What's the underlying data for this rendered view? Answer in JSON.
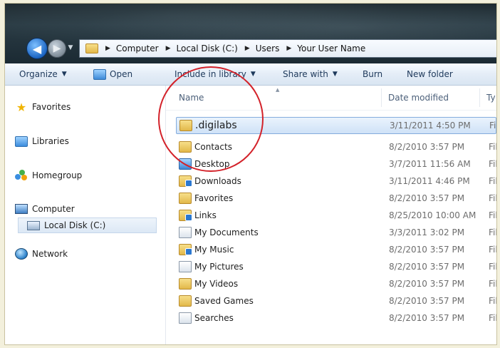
{
  "address_bar": {
    "crumbs": [
      "Computer",
      "Local Disk (C:)",
      "Users",
      "Your User Name"
    ]
  },
  "toolbar": {
    "organize": "Organize",
    "open": "Open",
    "include_in_library": "Include in library",
    "share_with": "Share with",
    "burn": "Burn",
    "new_folder": "New folder"
  },
  "nav_pane": {
    "favorites": "Favorites",
    "libraries": "Libraries",
    "homegroup": "Homegroup",
    "computer": "Computer",
    "local_disk": "Local Disk (C:)",
    "network": "Network"
  },
  "columns": {
    "name": "Name",
    "date_modified": "Date modified",
    "type": "Ty"
  },
  "files": [
    {
      "name": ".digilabs",
      "date": "3/11/2011 4:50 PM",
      "type": "Fil"
    },
    {
      "name": "Contacts",
      "date": "8/2/2010 3:57 PM",
      "type": "Fil"
    },
    {
      "name": "Desktop",
      "date": "3/7/2011 11:56 AM",
      "type": "Fil"
    },
    {
      "name": "Downloads",
      "date": "3/11/2011 4:46 PM",
      "type": "Fil"
    },
    {
      "name": "Favorites",
      "date": "8/2/2010 3:57 PM",
      "type": "Fil"
    },
    {
      "name": "Links",
      "date": "8/25/2010 10:00 AM",
      "type": "Fil"
    },
    {
      "name": "My Documents",
      "date": "3/3/2011 3:02 PM",
      "type": "Fil"
    },
    {
      "name": "My Music",
      "date": "8/2/2010 3:57 PM",
      "type": "Fil"
    },
    {
      "name": "My Pictures",
      "date": "8/2/2010 3:57 PM",
      "type": "Fil"
    },
    {
      "name": "My Videos",
      "date": "8/2/2010 3:57 PM",
      "type": "Fil"
    },
    {
      "name": "Saved Games",
      "date": "8/2/2010 3:57 PM",
      "type": "Fil"
    },
    {
      "name": "Searches",
      "date": "8/2/2010 3:57 PM",
      "type": "Fil"
    }
  ],
  "icons": {
    "back": "back-arrow-icon",
    "forward": "forward-arrow-icon",
    "favorites": "star-icon",
    "libraries": "library-icon",
    "homegroup": "homegroup-icon",
    "computer": "computer-icon",
    "local_disk": "disk-drive-icon",
    "network": "network-icon",
    "folder": "folder-icon"
  },
  "colors": {
    "annotation_circle": "#d3222a",
    "selection": "#cfe2f7",
    "toolbar_text": "#1e395b"
  }
}
